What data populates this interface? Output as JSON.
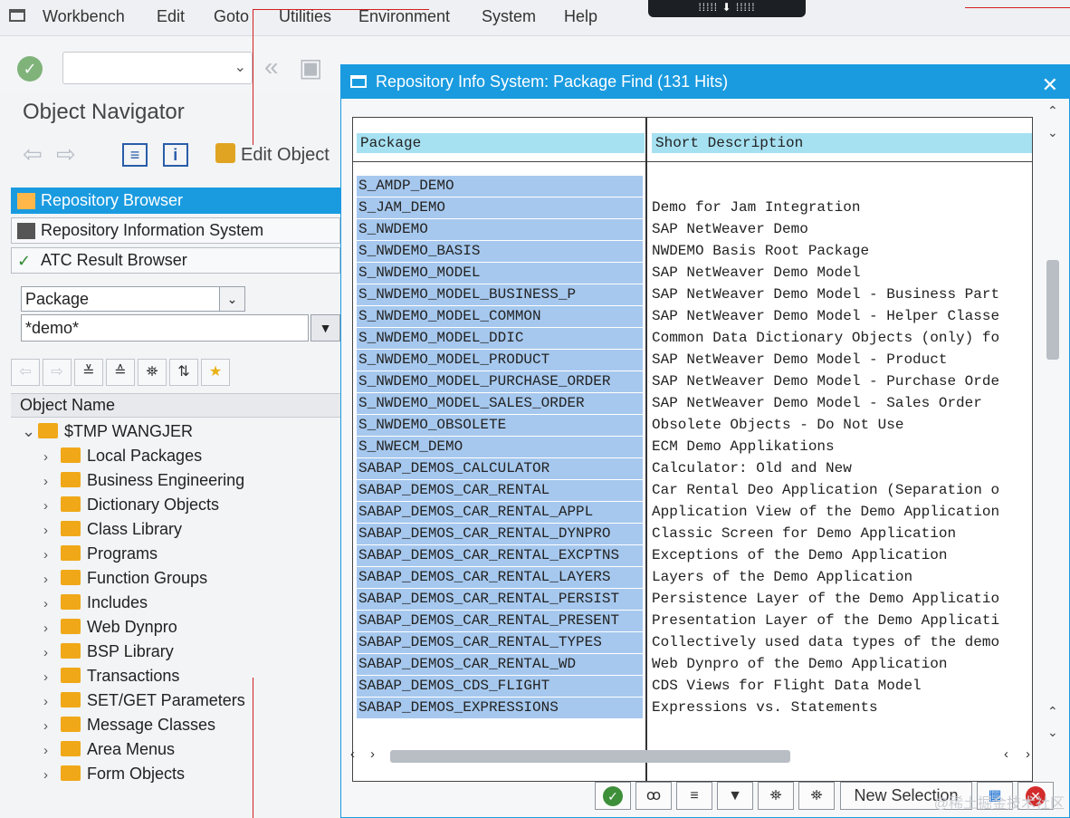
{
  "menu": {
    "items": [
      "Workbench",
      "Edit",
      "Goto",
      "Utilities",
      "Environment",
      "System",
      "Help"
    ],
    "center_indicator": "⁞⁞⁞⁞⁞ ⬇ ⁞⁞⁞⁞⁞"
  },
  "toolbar": {
    "command_field_value": ""
  },
  "navigator": {
    "title": "Object Navigator",
    "edit_object_label": "Edit Object",
    "tabs": [
      {
        "label": "Repository Browser",
        "active": true
      },
      {
        "label": "Repository Information System",
        "active": false
      },
      {
        "label": "ATC Result Browser",
        "active": false
      }
    ],
    "object_type": "Package",
    "object_value": "*demo*",
    "tree_header": "Object Name",
    "tree_root": "$TMP WANGJER",
    "tree_items": [
      "Local Packages",
      "Business Engineering",
      "Dictionary Objects",
      "Class Library",
      "Programs",
      "Function Groups",
      "Includes",
      "Web Dynpro",
      "BSP Library",
      "Transactions",
      "SET/GET Parameters",
      "Message Classes",
      "Area Menus",
      "Form Objects"
    ]
  },
  "dialog": {
    "title": "Repository Info System: Package Find (131 Hits)",
    "col_package": "Package",
    "col_description": "Short Description",
    "rows": [
      {
        "package": "S_AMDP_DEMO",
        "description": ""
      },
      {
        "package": "S_JAM_DEMO",
        "description": "Demo for Jam Integration"
      },
      {
        "package": "S_NWDEMO",
        "description": "SAP NetWeaver Demo"
      },
      {
        "package": "S_NWDEMO_BASIS",
        "description": "NWDEMO Basis Root Package"
      },
      {
        "package": "S_NWDEMO_MODEL",
        "description": "SAP NetWeaver Demo Model"
      },
      {
        "package": "S_NWDEMO_MODEL_BUSINESS_P",
        "description": "SAP NetWeaver Demo Model - Business Part"
      },
      {
        "package": "S_NWDEMO_MODEL_COMMON",
        "description": "SAP NetWeaver Demo Model - Helper Classe"
      },
      {
        "package": "S_NWDEMO_MODEL_DDIC",
        "description": "Common Data Dictionary Objects (only) fo"
      },
      {
        "package": "S_NWDEMO_MODEL_PRODUCT",
        "description": "SAP NetWeaver Demo Model - Product"
      },
      {
        "package": "S_NWDEMO_MODEL_PURCHASE_ORDER",
        "description": "SAP NetWeaver Demo Model - Purchase Orde"
      },
      {
        "package": "S_NWDEMO_MODEL_SALES_ORDER",
        "description": "SAP NetWeaver Demo Model - Sales Order"
      },
      {
        "package": "S_NWDEMO_OBSOLETE",
        "description": "Obsolete Objects - Do Not Use"
      },
      {
        "package": "S_NWECM_DEMO",
        "description": "ECM Demo Applikations"
      },
      {
        "package": "SABAP_DEMOS_CALCULATOR",
        "description": "Calculator: Old and New"
      },
      {
        "package": "SABAP_DEMOS_CAR_RENTAL",
        "description": "Car Rental Deo Application (Separation o"
      },
      {
        "package": "SABAP_DEMOS_CAR_RENTAL_APPL",
        "description": "Application View of the Demo Application"
      },
      {
        "package": "SABAP_DEMOS_CAR_RENTAL_DYNPRO",
        "description": "Classic Screen for Demo Application"
      },
      {
        "package": "SABAP_DEMOS_CAR_RENTAL_EXCPTNS",
        "description": "Exceptions of the Demo Application"
      },
      {
        "package": "SABAP_DEMOS_CAR_RENTAL_LAYERS",
        "description": "Layers of the Demo Application"
      },
      {
        "package": "SABAP_DEMOS_CAR_RENTAL_PERSIST",
        "description": "Persistence Layer of the Demo Applicatio"
      },
      {
        "package": "SABAP_DEMOS_CAR_RENTAL_PRESENT",
        "description": "Presentation Layer of the Demo Applicati"
      },
      {
        "package": "SABAP_DEMOS_CAR_RENTAL_TYPES",
        "description": "Collectively used data types of the demo"
      },
      {
        "package": "SABAP_DEMOS_CAR_RENTAL_WD",
        "description": "Web Dynpro of the Demo Application"
      },
      {
        "package": "SABAP_DEMOS_CDS_FLIGHT",
        "description": "CDS Views for Flight Data Model"
      },
      {
        "package": "SABAP_DEMOS_EXPRESSIONS",
        "description": "Expressions vs. Statements"
      }
    ],
    "new_selection_label": "New Selection"
  },
  "watermark": "@稀土掘金技术社区"
}
